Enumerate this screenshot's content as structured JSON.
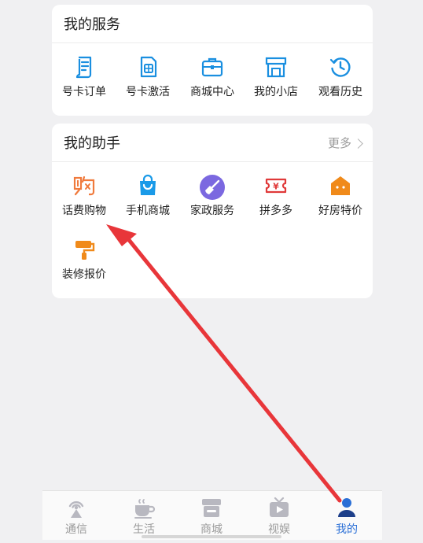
{
  "my_services": {
    "title": "我的服务",
    "items": [
      {
        "label": "号卡订单",
        "icon": "order-doc-icon"
      },
      {
        "label": "号卡激活",
        "icon": "sim-card-icon"
      },
      {
        "label": "商城中心",
        "icon": "briefcase-icon"
      },
      {
        "label": "我的小店",
        "icon": "store-icon"
      },
      {
        "label": "观看历史",
        "icon": "history-icon"
      }
    ]
  },
  "my_assistant": {
    "title": "我的助手",
    "more_label": "更多",
    "items": [
      {
        "label": "话费购物",
        "icon": "shopping-glyph-icon",
        "color": "#f07a3c"
      },
      {
        "label": "手机商城",
        "icon": "shopping-bag-icon",
        "color": "#1a9ae8"
      },
      {
        "label": "家政服务",
        "icon": "broom-icon",
        "color": "#7b68e0"
      },
      {
        "label": "拼多多",
        "icon": "coupon-ticket-icon",
        "color": "#e03a3a"
      },
      {
        "label": "好房特价",
        "icon": "house-icon",
        "color": "#f08a1a"
      },
      {
        "label": "装修报价",
        "icon": "paint-roller-icon",
        "color": "#f08a1a"
      }
    ]
  },
  "bottom_nav": {
    "items": [
      {
        "label": "通信",
        "icon": "signal-tower-icon",
        "active": false
      },
      {
        "label": "生活",
        "icon": "coffee-cup-icon",
        "active": false
      },
      {
        "label": "商城",
        "icon": "shop-icon",
        "active": false
      },
      {
        "label": "视娱",
        "icon": "video-icon",
        "active": false
      },
      {
        "label": "我的",
        "icon": "person-icon",
        "active": true
      }
    ]
  },
  "colors": {
    "service_icon_blue": "#1a8fe0",
    "accent_blue": "#2a6fd6",
    "annotation_arrow_red": "#e8363a"
  }
}
